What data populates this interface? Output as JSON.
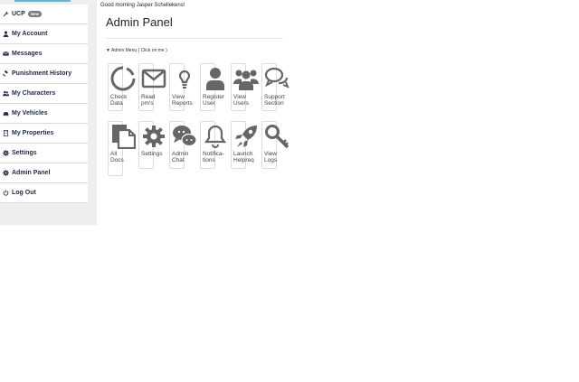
{
  "sidebar": {
    "items": [
      {
        "label": "UCP",
        "badge": "New",
        "icon": "wrench-icon"
      },
      {
        "label": "My Account",
        "icon": "user-icon"
      },
      {
        "label": "Messages",
        "icon": "envelope-icon"
      },
      {
        "label": "Punishment History",
        "icon": "gavel-icon"
      },
      {
        "label": "My Characters",
        "icon": "users-icon"
      },
      {
        "label": "My Vehicles",
        "icon": "car-icon"
      },
      {
        "label": "My Properties",
        "icon": "building-icon"
      },
      {
        "label": "Settings",
        "icon": "gear-icon"
      },
      {
        "label": "Admin Panel",
        "icon": "gear-icon"
      },
      {
        "label": "Log Out",
        "icon": "power-icon"
      }
    ]
  },
  "header": {
    "greeting": "Good morning Jasper Schellekens!",
    "title": "Admin Panel"
  },
  "admin_menu": {
    "toggle_label": "▼ Admin Menu ( Click on me )",
    "row1": [
      {
        "line1": "Check",
        "line2": "Data",
        "icon": "circle-notch-icon"
      },
      {
        "line1": "Read",
        "line2": "pm's",
        "icon": "envelope-icon"
      },
      {
        "line1": "View",
        "line2": "Reports",
        "icon": "lightbulb-icon"
      },
      {
        "line1": "Register",
        "line2": "User",
        "icon": "user-icon"
      },
      {
        "line1": "View",
        "line2": "Users",
        "icon": "users-icon"
      },
      {
        "line1": "Support",
        "line2": "Section",
        "icon": "comments-icon"
      }
    ],
    "row2": [
      {
        "line1": "All",
        "line2": "Docs",
        "icon": "files-icon"
      },
      {
        "line1": "Settings",
        "line2": "",
        "icon": "gear-icon"
      },
      {
        "line1": "Admin",
        "line2": "Chat",
        "icon": "chat-icon"
      },
      {
        "line1": "Notifica-",
        "line2": "tions",
        "icon": "bell-icon"
      },
      {
        "line1": "Launch",
        "line2": "Helpreq",
        "icon": "rocket-icon"
      },
      {
        "line1": "View",
        "line2": "Logs",
        "icon": "key-icon"
      }
    ]
  },
  "colors": {
    "icon": "#666666",
    "sidebar_bg": "#eeeeee",
    "accent": "#5bb8d9",
    "nav_text": "#1f2a44"
  }
}
